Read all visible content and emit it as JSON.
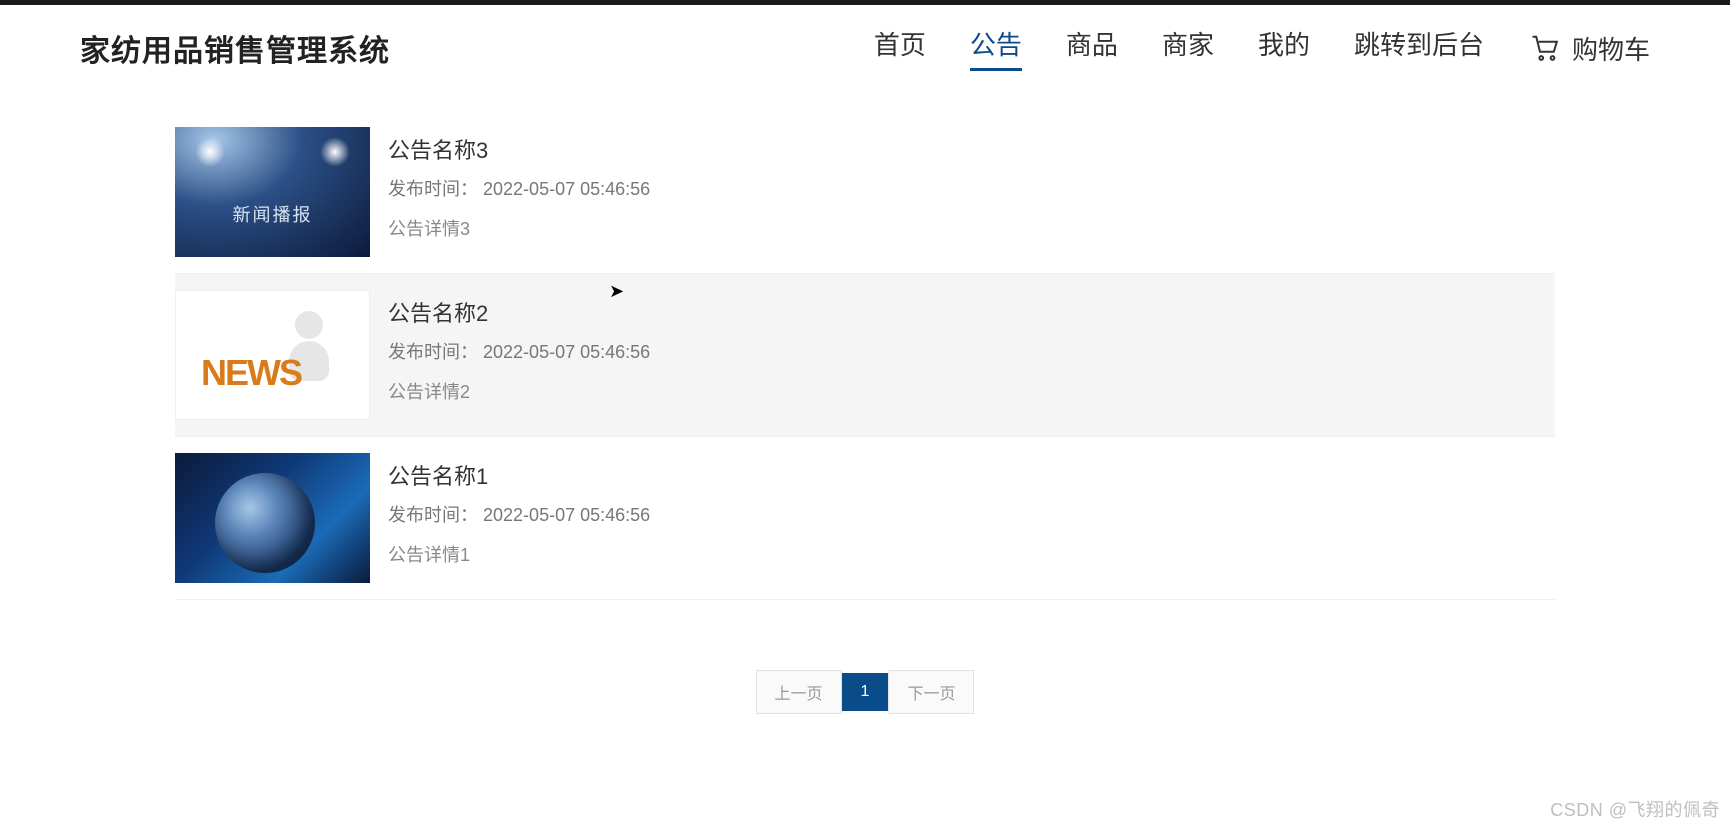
{
  "header": {
    "logo": "家纺用品销售管理系统",
    "nav": [
      {
        "label": "首页",
        "active": false
      },
      {
        "label": "公告",
        "active": true
      },
      {
        "label": "商品",
        "active": false
      },
      {
        "label": "商家",
        "active": false
      },
      {
        "label": "我的",
        "active": false
      },
      {
        "label": "跳转到后台",
        "active": false
      }
    ],
    "cart_label": "购物车"
  },
  "notices": [
    {
      "title": "公告名称3",
      "publish_label": "发布时间：",
      "publish_time": "2022-05-07 05:46:56",
      "detail": "公告详情3",
      "thumb_caption": "新闻播报",
      "hovered": false,
      "thumb": "broadcast"
    },
    {
      "title": "公告名称2",
      "publish_label": "发布时间：",
      "publish_time": "2022-05-07 05:46:56",
      "detail": "公告详情2",
      "thumb_caption": "NEWS",
      "hovered": true,
      "thumb": "news"
    },
    {
      "title": "公告名称1",
      "publish_label": "发布时间：",
      "publish_time": "2022-05-07 05:46:56",
      "detail": "公告详情1",
      "thumb_caption": "",
      "hovered": false,
      "thumb": "globe"
    }
  ],
  "pagination": {
    "prev": "上一页",
    "page": "1",
    "next": "下一页"
  },
  "watermark": "CSDN @飞翔的佩奇"
}
